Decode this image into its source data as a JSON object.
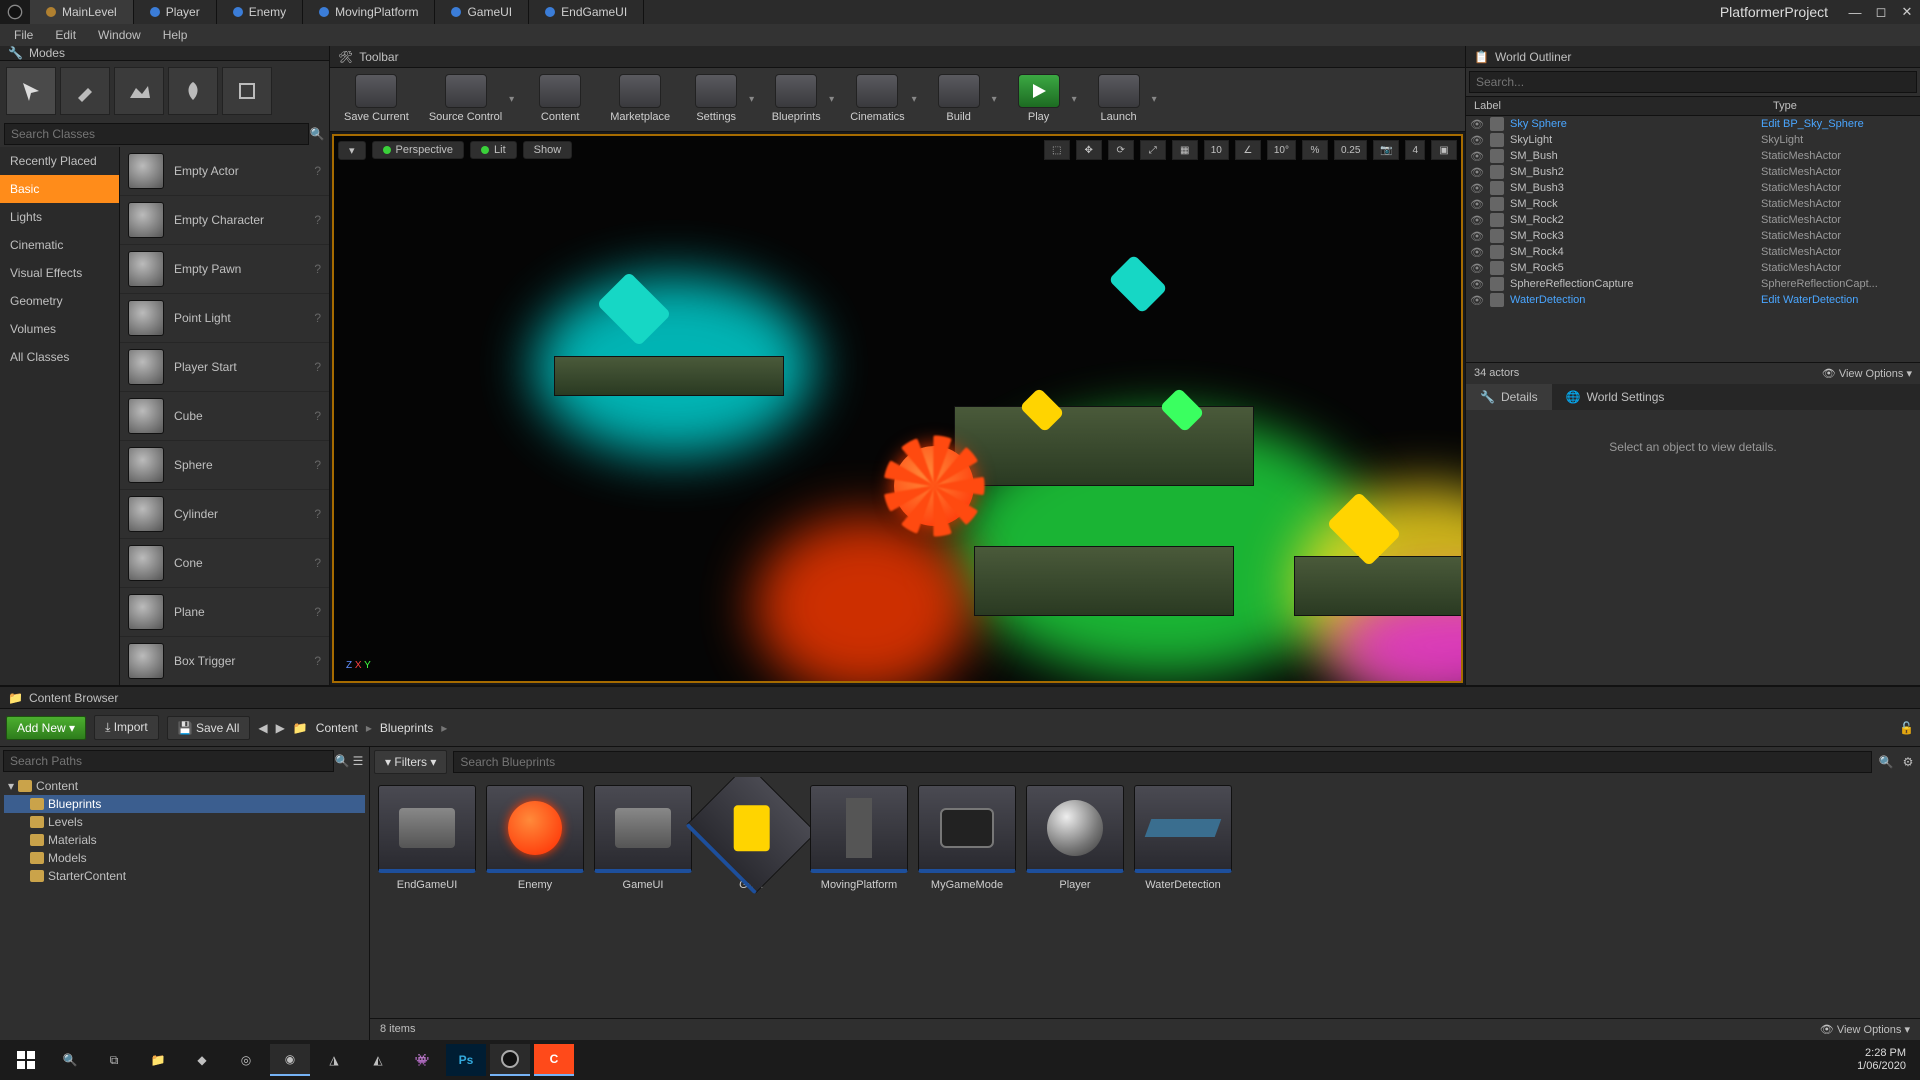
{
  "project_title": "PlatformerProject",
  "doc_tabs": [
    "MainLevel",
    "Player",
    "Enemy",
    "MovingPlatform",
    "GameUI",
    "EndGameUI"
  ],
  "menus": [
    "File",
    "Edit",
    "Window",
    "Help"
  ],
  "modes": {
    "title": "Modes",
    "search_placeholder": "Search Classes",
    "categories": [
      "Recently Placed",
      "Basic",
      "Lights",
      "Cinematic",
      "Visual Effects",
      "Geometry",
      "Volumes",
      "All Classes"
    ],
    "active_category": "Basic",
    "actors": [
      "Empty Actor",
      "Empty Character",
      "Empty Pawn",
      "Point Light",
      "Player Start",
      "Cube",
      "Sphere",
      "Cylinder",
      "Cone",
      "Plane",
      "Box Trigger"
    ]
  },
  "toolbar": {
    "title": "Toolbar",
    "buttons": [
      {
        "label": "Save Current",
        "split": false
      },
      {
        "label": "Source Control",
        "split": true
      },
      {
        "label": "Content",
        "split": false
      },
      {
        "label": "Marketplace",
        "split": false
      },
      {
        "label": "Settings",
        "split": true
      },
      {
        "label": "Blueprints",
        "split": true
      },
      {
        "label": "Cinematics",
        "split": true
      },
      {
        "label": "Build",
        "split": true
      },
      {
        "label": "Play",
        "split": true,
        "play": true
      },
      {
        "label": "Launch",
        "split": true
      }
    ]
  },
  "viewport": {
    "mode": "Perspective",
    "lit": "Lit",
    "show": "Show",
    "snap_grid": "10",
    "snap_angle": "10°",
    "snap_scale": "0.25",
    "cam_speed": "4"
  },
  "outliner": {
    "title": "World Outliner",
    "search_placeholder": "Search...",
    "col_label": "Label",
    "col_type": "Type",
    "rows": [
      {
        "label": "Sky Sphere",
        "type": "Edit BP_Sky_Sphere",
        "edit": true
      },
      {
        "label": "SkyLight",
        "type": "SkyLight"
      },
      {
        "label": "SM_Bush",
        "type": "StaticMeshActor"
      },
      {
        "label": "SM_Bush2",
        "type": "StaticMeshActor"
      },
      {
        "label": "SM_Bush3",
        "type": "StaticMeshActor"
      },
      {
        "label": "SM_Rock",
        "type": "StaticMeshActor"
      },
      {
        "label": "SM_Rock2",
        "type": "StaticMeshActor"
      },
      {
        "label": "SM_Rock3",
        "type": "StaticMeshActor"
      },
      {
        "label": "SM_Rock4",
        "type": "StaticMeshActor"
      },
      {
        "label": "SM_Rock5",
        "type": "StaticMeshActor"
      },
      {
        "label": "SphereReflectionCapture",
        "type": "SphereReflectionCapt..."
      },
      {
        "label": "WaterDetection",
        "type": "Edit WaterDetection",
        "edit": true
      }
    ],
    "count": "34 actors",
    "view_options": "View Options"
  },
  "details": {
    "tab_details": "Details",
    "tab_world": "World Settings",
    "empty": "Select an object to view details."
  },
  "content_browser": {
    "title": "Content Browser",
    "add_new": "Add New",
    "import": "Import",
    "save_all": "Save All",
    "breadcrumbs": [
      "Content",
      "Blueprints"
    ],
    "search_paths_placeholder": "Search Paths",
    "filters": "Filters",
    "search_assets_placeholder": "Search Blueprints",
    "tree": [
      {
        "label": "Content",
        "depth": 0
      },
      {
        "label": "Blueprints",
        "depth": 1,
        "selected": true
      },
      {
        "label": "Levels",
        "depth": 1
      },
      {
        "label": "Materials",
        "depth": 1
      },
      {
        "label": "Models",
        "depth": 1
      },
      {
        "label": "StarterContent",
        "depth": 1
      }
    ],
    "assets": [
      {
        "name": "EndGameUI",
        "kind": "ui"
      },
      {
        "name": "Enemy",
        "kind": "enemy"
      },
      {
        "name": "GameUI",
        "kind": "ui"
      },
      {
        "name": "Gem",
        "kind": "gem"
      },
      {
        "name": "MovingPlatform",
        "kind": "plat"
      },
      {
        "name": "MyGameMode",
        "kind": "mode"
      },
      {
        "name": "Player",
        "kind": "sphere"
      },
      {
        "name": "WaterDetection",
        "kind": "water"
      }
    ],
    "count": "8 items",
    "view_options": "View Options"
  },
  "taskbar": {
    "time": "2:28 PM",
    "date": "1/06/2020"
  }
}
